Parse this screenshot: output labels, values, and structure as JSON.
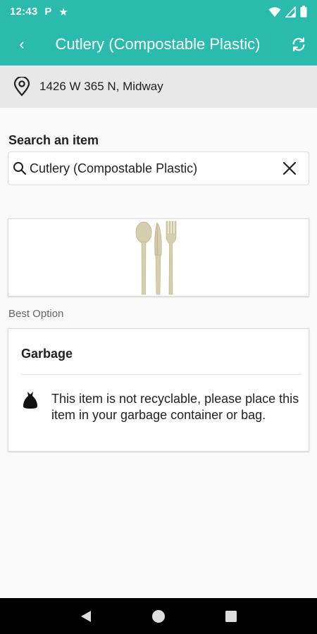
{
  "status_bar": {
    "time": "12:43",
    "left_icons": [
      "parking-icon",
      "star-icon"
    ],
    "right_icons": [
      "wifi-icon",
      "signal-icon",
      "battery-icon"
    ],
    "p_glyph": "P",
    "star_glyph": "★"
  },
  "app_bar": {
    "title": "Cutlery (Compostable Plastic)",
    "back_icon": "chevron-left-icon",
    "refresh_icon": "refresh-icon",
    "back_glyph": "‹"
  },
  "address": {
    "text": "1426 W 365 N, Midway",
    "icon": "location-pin-icon"
  },
  "search": {
    "label": "Search an item",
    "value": "Cutlery (Compostable Plastic)",
    "search_icon": "search-icon",
    "clear_icon": "close-icon"
  },
  "item_image": {
    "icon": "cutlery-image"
  },
  "best_option": {
    "label": "Best Option",
    "title": "Garbage",
    "description": "This item is not recyclable, please place this item in your garbage container or bag.",
    "icon": "garbage-bag-icon"
  },
  "nav_bar": {
    "icons": [
      "back-triangle-icon",
      "home-circle-icon",
      "recents-square-icon"
    ]
  },
  "colors": {
    "accent": "#2bbbad",
    "cutlery": "#d6cfae"
  }
}
